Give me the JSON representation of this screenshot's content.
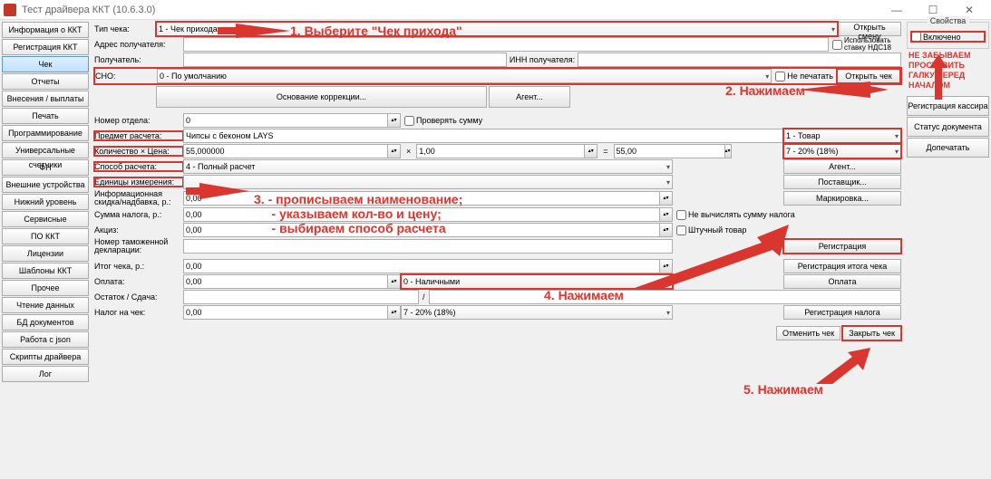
{
  "window": {
    "title": "Тест драйвера ККТ (10.6.3.0)"
  },
  "sidebar_left": {
    "items": [
      "Информация о ККТ",
      "Регистрация ККТ",
      "Чек",
      "Отчеты",
      "Внесения / выплаты",
      "Печать",
      "Программирование",
      "Универсальные счетчики",
      "ФН",
      "Внешние устройства",
      "Нижний уровень",
      "Сервисные",
      "ПО ККТ",
      "Лицензии",
      "Шаблоны ККТ",
      "Прочее",
      "Чтение данных",
      "БД документов",
      "Работа с json",
      "Скрипты драйвера",
      "Лог"
    ],
    "active_index": 2
  },
  "sidebar_right": {
    "group_title": "Свойства",
    "vklucheno": "Включено",
    "buttons": [
      "Регистрация кассира",
      "Статус документа",
      "Допечатать"
    ],
    "warn": "НЕ ЗАБЫВАЕМ\nПРОСТАВИТЬ\nГАЛКУ ПЕРЕД\nНАЧАЛОМ"
  },
  "form": {
    "tip_cheka_lbl": "Тип чека:",
    "tip_cheka_val": "1 - Чек прихода",
    "adres_lbl": "Адрес получателя:",
    "poluchatel_lbl": "Получатель:",
    "inn_lbl": "ИНН получателя:",
    "sno_lbl": "СНО:",
    "sno_val": "0 - По умолчанию",
    "otkryt_smenu": "Открыть смену",
    "nds18_chk": "Использовать ставку НДС18",
    "ne_pechatat": "Не печатать",
    "osnovanie_lbl": "Основание коррекции...",
    "agent_btn": "Агент...",
    "otkryt_chek": "Открыть чек",
    "nomer_otdela_lbl": "Номер отдела:",
    "nomer_otdela_val": "0",
    "proveryat_summu": "Проверять сумму",
    "predmet_lbl": "Предмет расчета:",
    "predmet_val": "Чипсы с беконом LAYS",
    "predmet_type": "1 - Товар",
    "kolxcena_lbl": "Количество × Цена:",
    "kolvo_val": "55,000000",
    "x_sym": "×",
    "cena_val": "1,00",
    "eq_sym": "=",
    "summa_val": "55,00",
    "nds_val": "7 - 20% (18%)",
    "sposob_lbl": "Способ расчета:",
    "sposob_val": "4 - Полный расчет",
    "agent2_btn": "Агент...",
    "edinicy_lbl": "Единицы измерения:",
    "postavshik_btn": "Поставщик...",
    "skidka_lbl": "Информационная скидка/надбавка, р.:",
    "skidka_val": "0,00",
    "markirovka_btn": "Маркировка...",
    "summa_naloga_lbl": "Сумма налога, р.:",
    "summa_naloga_val": "0,00",
    "ne_vychislyat": "Не вычислять сумму налога",
    "akciz_lbl": "Акциз:",
    "akciz_val": "0,00",
    "shtuchnyj": "Штучный товар",
    "nomer_tamozh_lbl": "Номер таможенной декларации:",
    "registraciya_btn": "Регистрация",
    "itog_lbl": "Итог чека, р.:",
    "itog_val": "0,00",
    "reg_itog_btn": "Регистрация итога чека",
    "oplata_lbl": "Оплата:",
    "oplata_val": "0,00",
    "oplata_type": "0 - Наличными",
    "oplata_btn": "Оплата",
    "ostatok_lbl": "Остаток / Сдача:",
    "slash": "/",
    "nalog_lbl": "Налог на чек:",
    "nalog_val": "0,00",
    "nalog_type": "7 - 20% (18%)",
    "reg_naloga_btn": "Регистрация налога",
    "otmenit_btn": "Отменить чек",
    "zakryt_btn": "Закрыть чек"
  },
  "annotations": {
    "a1": "1. Выберите \"Чек прихода\"",
    "a2": "2. Нажимаем",
    "a3": "3. - прописываем наименование;\n     - указываем кол-во и цену;\n     - выбираем способ расчета",
    "a4": "4. Нажимаем",
    "a5": "5. Нажимаем"
  }
}
